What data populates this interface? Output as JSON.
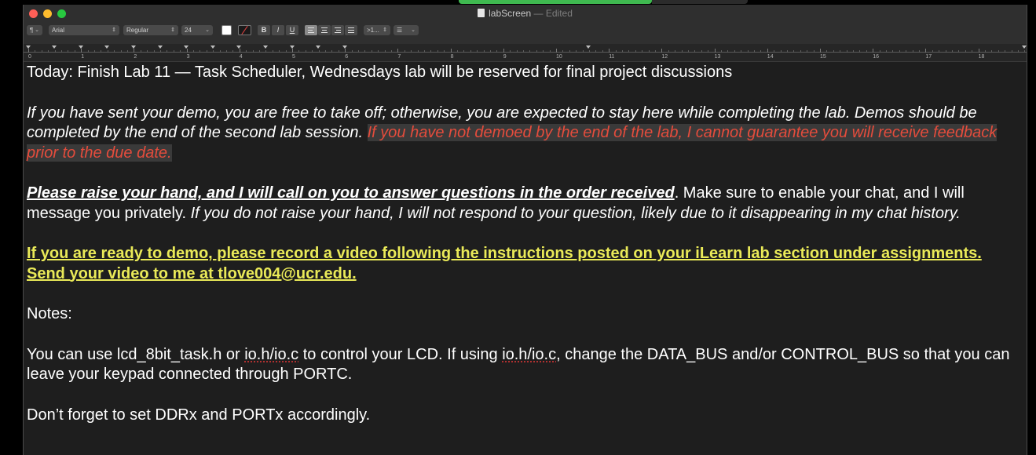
{
  "window": {
    "title": "labScreen",
    "title_status": "— Edited"
  },
  "toolbar": {
    "paragraph_style": "¶",
    "font_family": "Arial",
    "font_style": "Regular",
    "font_size": "24",
    "bold": "B",
    "italic": "I",
    "underline": "U",
    "spacing": ">1...",
    "list": ""
  },
  "ruler": {
    "numbers": [
      "0",
      "1",
      "2",
      "3",
      "4",
      "5",
      "6",
      "7",
      "8",
      "9",
      "10",
      "11",
      "12",
      "13",
      "14",
      "15",
      "16",
      "17",
      "18"
    ]
  },
  "document": {
    "line1": "Today: Finish Lab 11 — Task Scheduler, Wednesdays lab will be reserved for final project discussions",
    "p2_italic": "If you have sent your demo, you are free to take off; otherwise, you are expected to stay here while completing the lab.  Demos should be completed by the end of the second lab session. ",
    "p2_red": "If you have not demoed by the end of the lab, I cannot guarantee you will receive feedback prior to the due date.",
    "p3_bold": "Please raise your hand, and I will call on you to answer questions in the order received",
    "p3_plain": ". Make sure to enable your chat, and I will message you privately. ",
    "p3_italic": "If you do not raise your hand, I will not respond to your question, likely due to it disappearing in my chat history.",
    "p4_yellow": "If you are ready to demo, please record a video following the instructions posted on your iLearn lab section under assignments. Send your video to me at tlove004@ucr.edu.",
    "p5": "Notes:",
    "p6_a": "You can use lcd_8bit_task.h or ",
    "p6_b": "io.h/io.c",
    "p6_c": " to control your LCD.  If using ",
    "p6_d": "io.h/io.c",
    "p6_e": ", change the DATA_BUS and/or CONTROL_BUS so that you can leave your keypad connected through PORTC.",
    "p7": "Don’t forget to set DDRx and PORTx accordingly."
  }
}
